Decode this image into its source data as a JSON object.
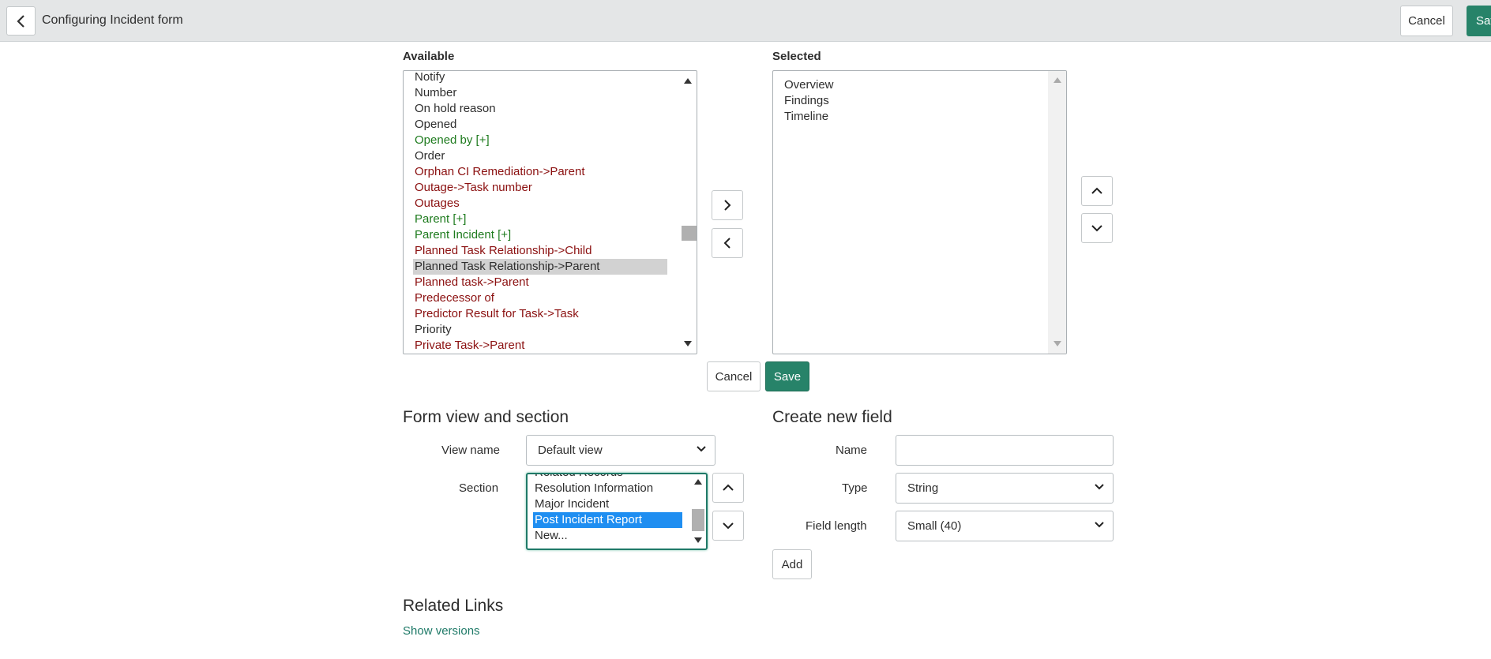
{
  "header": {
    "title": "Configuring Incident form",
    "cancel_label": "Cancel",
    "save_label": "Sav"
  },
  "slushbucket": {
    "available_label": "Available",
    "selected_label": "Selected",
    "available_items": [
      {
        "label": "Notify",
        "color": "normal"
      },
      {
        "label": "Number",
        "color": "normal"
      },
      {
        "label": "On hold reason",
        "color": "normal"
      },
      {
        "label": "Opened",
        "color": "normal"
      },
      {
        "label": "Opened by [+]",
        "color": "green"
      },
      {
        "label": "Order",
        "color": "normal"
      },
      {
        "label": "Orphan CI Remediation->Parent",
        "color": "red"
      },
      {
        "label": "Outage->Task number",
        "color": "red"
      },
      {
        "label": "Outages",
        "color": "red"
      },
      {
        "label": "Parent [+]",
        "color": "green"
      },
      {
        "label": "Parent Incident [+]",
        "color": "green"
      },
      {
        "label": "Planned Task Relationship->Child",
        "color": "red"
      },
      {
        "label": "Planned Task Relationship->Parent",
        "color": "normal",
        "selected": true
      },
      {
        "label": "Planned task->Parent",
        "color": "red"
      },
      {
        "label": "Predecessor of",
        "color": "red"
      },
      {
        "label": "Predictor Result for Task->Task",
        "color": "red"
      },
      {
        "label": "Priority",
        "color": "normal"
      },
      {
        "label": "Private Task->Parent",
        "color": "red"
      }
    ],
    "selected_items": [
      "Overview",
      "Findings",
      "Timeline"
    ],
    "cancel_label": "Cancel",
    "save_label": "Save"
  },
  "form_view": {
    "title": "Form view and section",
    "view_name_label": "View name",
    "view_name_value": "Default view",
    "section_label": "Section",
    "section_items": [
      {
        "label": "Related Records",
        "partial": true
      },
      {
        "label": "Resolution Information"
      },
      {
        "label": "Major Incident"
      },
      {
        "label": "Post Incident Report",
        "selected": true
      },
      {
        "label": "New..."
      }
    ]
  },
  "create_field": {
    "title": "Create new field",
    "name_label": "Name",
    "name_value": "",
    "type_label": "Type",
    "type_value": "String",
    "length_label": "Field length",
    "length_value": "Small (40)",
    "add_label": "Add"
  },
  "related_links": {
    "title": "Related Links",
    "show_versions": "Show versions"
  },
  "colors": {
    "primary": "#278369",
    "link": "#1f7a68",
    "red_item": "#8b1010",
    "green_item": "#1e7b1e",
    "selection_blue": "#1f8ef1"
  }
}
